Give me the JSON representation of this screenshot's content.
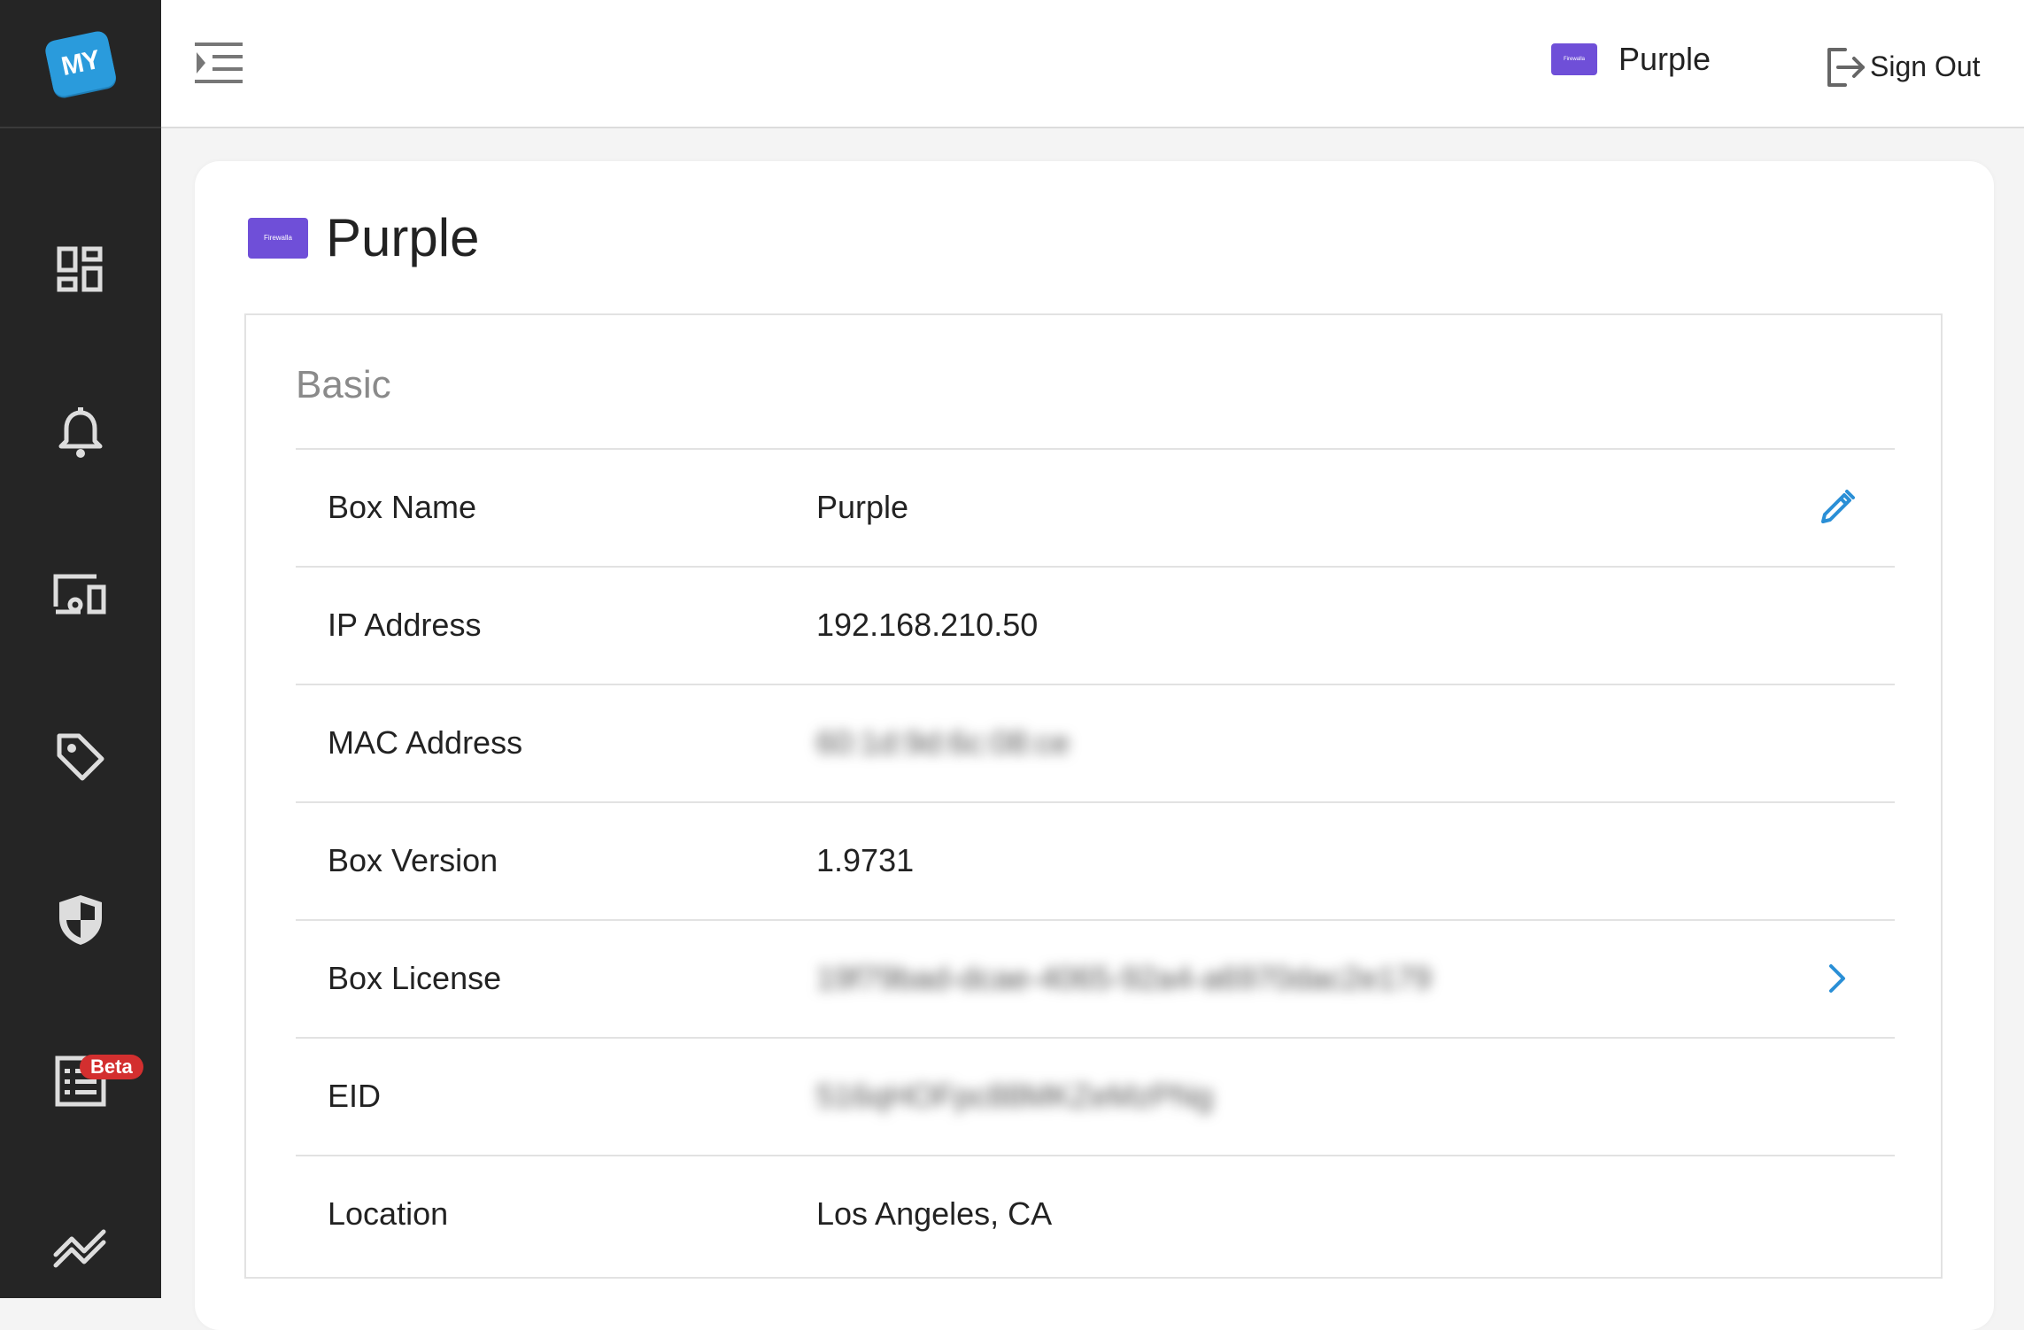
{
  "sidebar": {
    "logo_text": "MY",
    "items": [
      {
        "name": "dashboard-icon"
      },
      {
        "name": "bell-icon"
      },
      {
        "name": "devices-icon"
      },
      {
        "name": "tag-icon"
      },
      {
        "name": "shield-icon"
      },
      {
        "name": "list-icon",
        "badge": "Beta"
      },
      {
        "name": "trend-icon"
      }
    ]
  },
  "header": {
    "box_badge": "Firewalla",
    "box_name": "Purple",
    "signout_label": "Sign Out"
  },
  "page": {
    "badge_text": "Firewalla",
    "title": "Purple",
    "section_title": "Basic",
    "rows": [
      {
        "label": "Box Name",
        "value": "Purple",
        "action": "pencil-icon"
      },
      {
        "label": "IP Address",
        "value": "192.168.210.50"
      },
      {
        "label": "MAC Address",
        "value": "60:1d:9d:6c:08:ce",
        "blurred": true
      },
      {
        "label": "Box Version",
        "value": "1.9731"
      },
      {
        "label": "Box License",
        "value": "19f79bad-dcae-4065-92a4-a6970dac2e179",
        "blurred": true,
        "action": "chevron-right-icon"
      },
      {
        "label": "EID",
        "value": "516qHOFpc88MKZeMzPNg",
        "blurred": true
      },
      {
        "label": "Location",
        "value": "Los Angeles, CA"
      }
    ]
  },
  "colors": {
    "sidebar_bg": "#252525",
    "accent_blue": "#2a8fd6",
    "box_purple": "#6f4fd8",
    "beta_red": "#d32f2f"
  }
}
